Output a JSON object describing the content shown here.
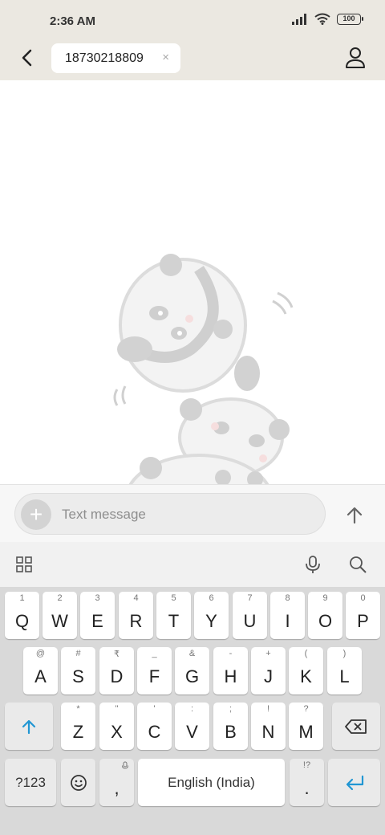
{
  "status_bar": {
    "time": "2:36 AM",
    "battery": "100"
  },
  "header": {
    "recipient": "18730218809",
    "remove_icon": "×"
  },
  "composer": {
    "plus_icon": "+",
    "placeholder": "Text message"
  },
  "keyboard": {
    "row1": [
      {
        "main": "Q",
        "hint": "1"
      },
      {
        "main": "W",
        "hint": "2"
      },
      {
        "main": "E",
        "hint": "3"
      },
      {
        "main": "R",
        "hint": "4"
      },
      {
        "main": "T",
        "hint": "5"
      },
      {
        "main": "Y",
        "hint": "6"
      },
      {
        "main": "U",
        "hint": "7"
      },
      {
        "main": "I",
        "hint": "8"
      },
      {
        "main": "O",
        "hint": "9"
      },
      {
        "main": "P",
        "hint": "0"
      }
    ],
    "row2": [
      {
        "main": "A",
        "hint": "@"
      },
      {
        "main": "S",
        "hint": "#"
      },
      {
        "main": "D",
        "hint": "₹"
      },
      {
        "main": "F",
        "hint": "_"
      },
      {
        "main": "G",
        "hint": "&"
      },
      {
        "main": "H",
        "hint": "-"
      },
      {
        "main": "J",
        "hint": "+"
      },
      {
        "main": "K",
        "hint": "("
      },
      {
        "main": "L",
        "hint": ")"
      }
    ],
    "row3": [
      {
        "main": "Z",
        "hint": "*"
      },
      {
        "main": "X",
        "hint": "\""
      },
      {
        "main": "C",
        "hint": "'"
      },
      {
        "main": "V",
        "hint": ":"
      },
      {
        "main": "B",
        "hint": ";"
      },
      {
        "main": "N",
        "hint": "!"
      },
      {
        "main": "M",
        "hint": "?"
      }
    ],
    "symbols_label": "?123",
    "comma_label": ",",
    "space_label": "English (India)",
    "period_label": ".",
    "period_hint": "!?",
    "accent_color": "#2196d3"
  }
}
